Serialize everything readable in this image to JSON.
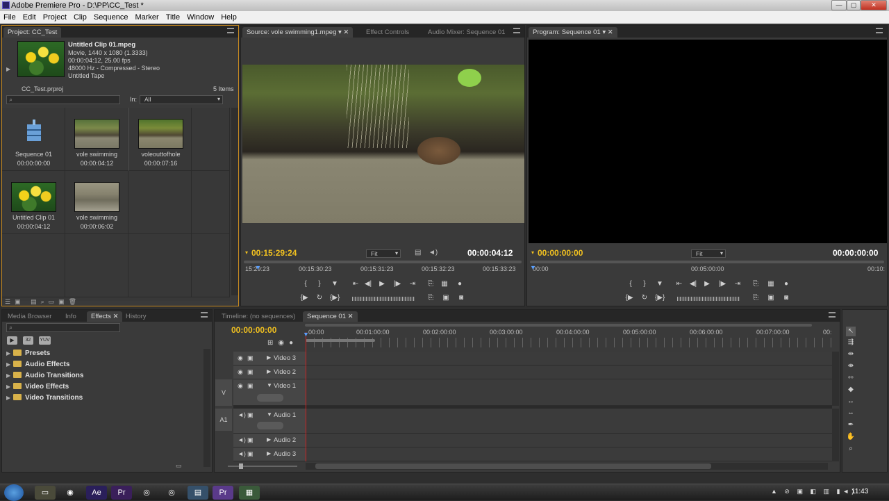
{
  "window": {
    "title": "Adobe Premiere Pro - D:\\PP\\CC_Test *",
    "controls": [
      "—",
      "▢",
      "✕"
    ]
  },
  "menu": [
    "File",
    "Edit",
    "Project",
    "Clip",
    "Sequence",
    "Marker",
    "Title",
    "Window",
    "Help"
  ],
  "project": {
    "tab": "Project: CC_Test",
    "preview": {
      "name": "Untitled Clip 01.mpeg",
      "line1": "Movie, 1440 x 1080 (1.3333)",
      "line2": "00:00:04:12, 25.00 fps",
      "line3": "48000 Hz - Compressed - Stereo",
      "line4": "Untitled Tape"
    },
    "file": "CC_Test.prproj",
    "count": "5 Items",
    "search_icon": "search-icon",
    "in_label": "In:",
    "in_value": "All",
    "items": [
      {
        "name": "Sequence 01",
        "duration": "00:00:00:00",
        "kind": "sequence"
      },
      {
        "name": "vole swimming",
        "duration": "00:00:04:12",
        "kind": "vole"
      },
      {
        "name": "voleouttofhole",
        "duration": "00:00:07:16",
        "kind": "vole"
      },
      {
        "name": "Untitled Clip 01",
        "duration": "00:00:04:12",
        "kind": "daffodil"
      },
      {
        "name": "vole swimming",
        "duration": "00:00:06:02",
        "kind": "vole2"
      }
    ]
  },
  "source": {
    "tabs": [
      "Source: vole swimming1.mpeg",
      "Effect Controls",
      "Audio Mixer: Sequence 01"
    ],
    "timecode_current": "00:15:29:24",
    "fit": "Fit",
    "timecode_duration": "00:00:04:12",
    "ruler": [
      "15:29:23",
      "00:15:30:23",
      "00:15:31:23",
      "00:15:32:23",
      "00:15:33:23"
    ]
  },
  "program": {
    "tab": "Program: Sequence 01",
    "timecode_current": "00:00:00:00",
    "fit": "Fit",
    "timecode_duration": "00:00:00:00",
    "ruler": [
      "00:00",
      "00:05:00:00",
      "00:10:"
    ]
  },
  "effects": {
    "tabs": [
      "Media Browser",
      "Info",
      "Effects",
      "History"
    ],
    "folders": [
      "Presets",
      "Audio Effects",
      "Audio Transitions",
      "Video Effects",
      "Video Transitions"
    ],
    "icons": [
      "accelerated-effects-icon",
      "32-bit-icon",
      "yuv-icon"
    ]
  },
  "timeline": {
    "tabs": [
      "Timeline: (no sequences)",
      "Sequence 01"
    ],
    "timecode": "00:00:00:00",
    "ruler": [
      "00:00",
      "00:01:00:00",
      "00:02:00:00",
      "00:03:00:00",
      "00:04:00:00",
      "00:05:00:00",
      "00:06:00:00",
      "00:07:00:00",
      "00:"
    ],
    "video_tracks": [
      "Video 3",
      "Video 2",
      "Video 1"
    ],
    "audio_tracks": [
      "Audio 1",
      "Audio 2",
      "Audio 3"
    ],
    "video_target": "V",
    "audio_target": "A1"
  },
  "taskbar": {
    "clock": "11:43"
  },
  "colors": {
    "accent_timecode": "#f0c020",
    "playhead": "#d02020",
    "panel": "#3a3a3a"
  }
}
